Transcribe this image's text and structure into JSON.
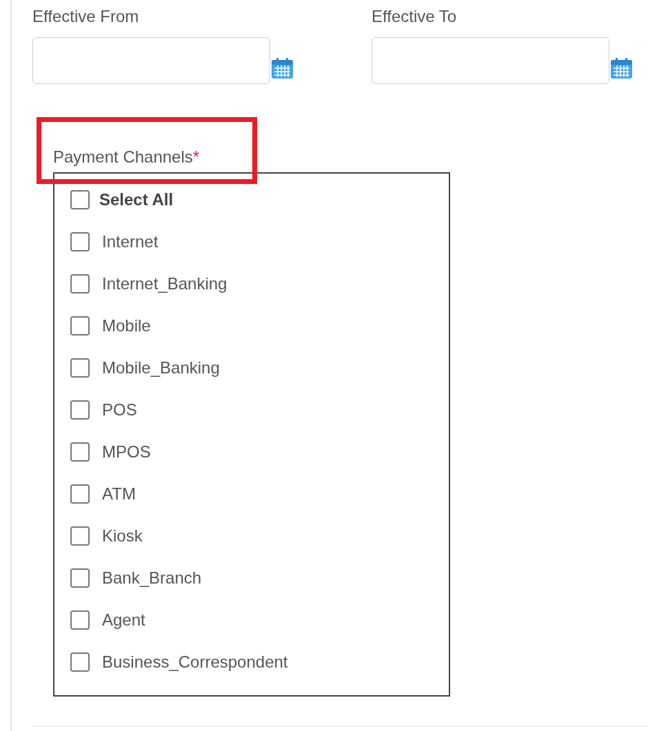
{
  "date_fields": [
    {
      "label": "Effective From"
    },
    {
      "label": "Effective To"
    }
  ],
  "payment_channels": {
    "label": "Payment Channels",
    "required_mark": "*",
    "highlighted": true,
    "options": [
      {
        "kind": "select-all",
        "label": "Select All",
        "checked": false
      },
      {
        "kind": "option",
        "label": "Internet",
        "checked": false
      },
      {
        "kind": "option",
        "label": "Internet_Banking",
        "checked": false
      },
      {
        "kind": "option",
        "label": "Mobile",
        "checked": false
      },
      {
        "kind": "option",
        "label": "Mobile_Banking",
        "checked": false
      },
      {
        "kind": "option",
        "label": "POS",
        "checked": false
      },
      {
        "kind": "option",
        "label": "MPOS",
        "checked": false
      },
      {
        "kind": "option",
        "label": "ATM",
        "checked": false
      },
      {
        "kind": "option",
        "label": "Kiosk",
        "checked": false
      },
      {
        "kind": "option",
        "label": "Bank_Branch",
        "checked": false
      },
      {
        "kind": "option",
        "label": "Agent",
        "checked": false
      },
      {
        "kind": "option",
        "label": "Business_Correspondent",
        "checked": false
      }
    ]
  }
}
